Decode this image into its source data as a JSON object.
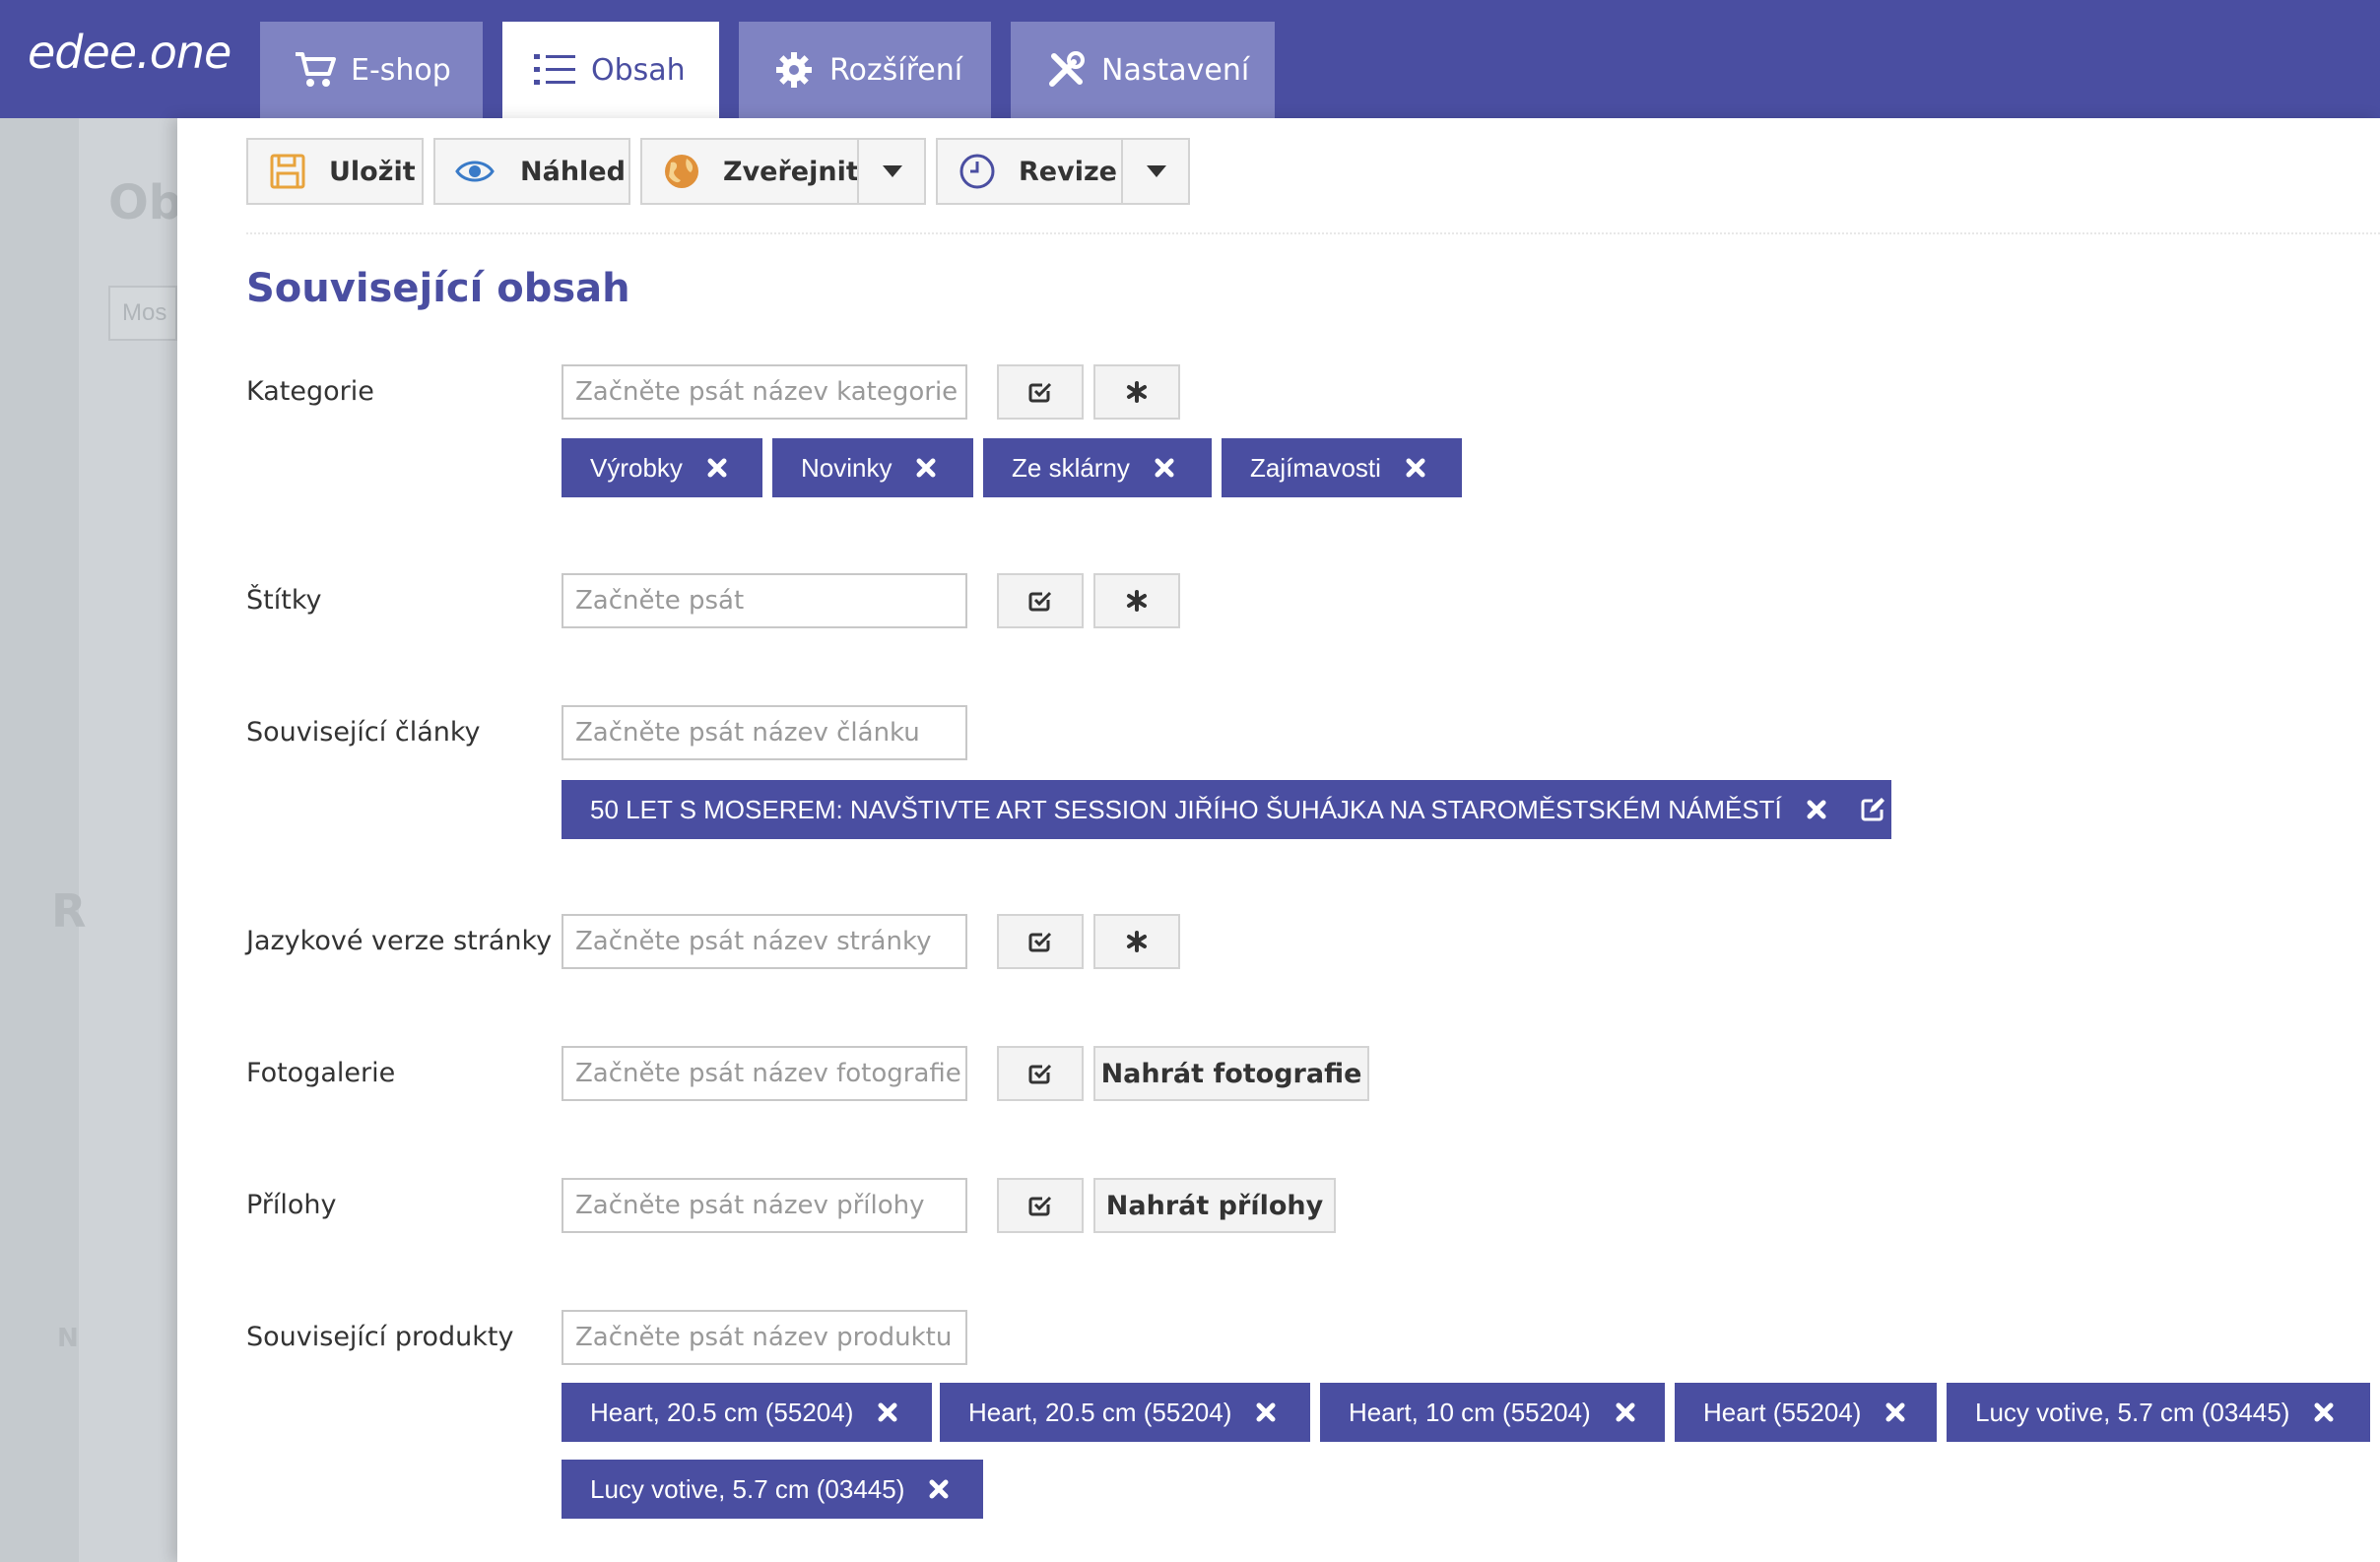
{
  "app": {
    "logo": "edee.one"
  },
  "tabs": [
    {
      "label": "E-shop",
      "icon": "cart-icon",
      "active": false
    },
    {
      "label": "Obsah",
      "icon": "list-icon",
      "active": true
    },
    {
      "label": "Rozšíření",
      "icon": "gear-icon",
      "active": false
    },
    {
      "label": "Nastavení",
      "icon": "tools-icon",
      "active": false
    }
  ],
  "background_ghost": {
    "title": "Ob",
    "search": "Mos",
    "letter_r": "R",
    "letter_n": "N"
  },
  "toolbar": {
    "save": "Uložit",
    "preview": "Náhled",
    "publish": "Zveřejnit",
    "revisions": "Revize"
  },
  "section_title": "Související obsah",
  "fields": {
    "categories": {
      "label": "Kategorie",
      "placeholder": "Začněte psát název kategorie",
      "chips": [
        "Výrobky",
        "Novinky",
        "Ze sklárny",
        "Zajímavosti"
      ]
    },
    "tags": {
      "label": "Štítky",
      "placeholder": "Začněte psát"
    },
    "articles": {
      "label": "Související články",
      "placeholder": "Začněte psát název článku",
      "chips": [
        "50 LET S MOSEREM: NAVŠTIVTE ART SESSION JIŘÍHO ŠUHÁJKA NA STAROMĚSTSKÉM NÁMĚSTÍ"
      ]
    },
    "languages": {
      "label": "Jazykové verze stránky",
      "placeholder": "Začněte psát název stránky"
    },
    "gallery": {
      "label": "Fotogalerie",
      "placeholder": "Začněte psát název fotografie",
      "upload": "Nahrát fotografie"
    },
    "attachments": {
      "label": "Přílohy",
      "placeholder": "Začněte psát název přílohy",
      "upload": "Nahrát přílohy"
    },
    "products": {
      "label": "Související produkty",
      "placeholder": "Začněte psát název produktu",
      "chips": [
        "Heart, 20.5 cm (55204)",
        "Heart, 20.5 cm (55204)",
        "Heart, 10 cm (55204)",
        "Heart (55204)",
        "Lucy votive, 5.7 cm (03445)",
        "Lucy votive, 5.7 cm (03445)"
      ]
    }
  },
  "colors": {
    "brand": "#4a4ea1",
    "tab_inactive": "#7f83c2",
    "button_bg": "#f5f5f5",
    "save_icon": "#e8a33c",
    "preview_icon": "#3a7bc8",
    "publish_icon": "#e0913a"
  }
}
